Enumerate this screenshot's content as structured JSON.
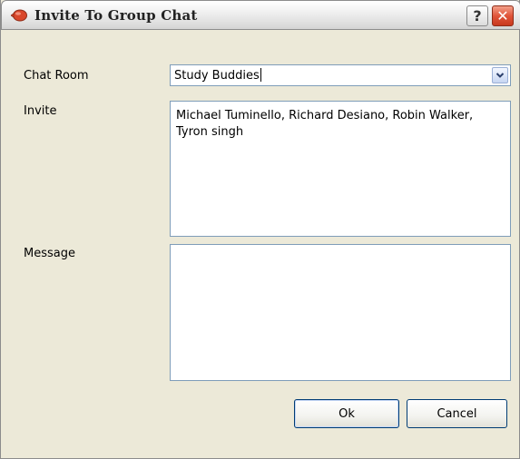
{
  "window": {
    "title": "Invite To Group Chat",
    "help_glyph": "?",
    "close_glyph": "✕"
  },
  "form": {
    "chat_room_label": "Chat Room",
    "chat_room_value": "Study Buddies",
    "invite_label": "Invite",
    "invite_value": "Michael Tuminello, Richard Desiano, Robin Walker, Tyron singh",
    "message_label": "Message",
    "message_value": ""
  },
  "buttons": {
    "ok_label": "Ok",
    "cancel_label": "Cancel"
  },
  "colors": {
    "accent_close": "#e0553a",
    "input_border": "#7f9db9",
    "dialog_bg": "#ece9d8"
  },
  "icons": {
    "title_icon": "chat-bubble-icon",
    "combo_arrow": "chevron-down-icon"
  }
}
